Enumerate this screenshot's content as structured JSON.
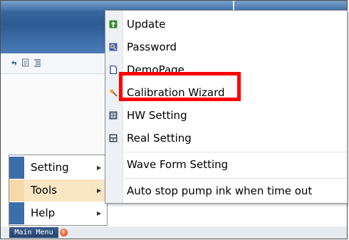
{
  "colors": {
    "accent": "#3d6ea7",
    "selected": "#fbe6c4",
    "highlight_box": "#ff0000"
  },
  "start_menu": {
    "items": [
      {
        "label": "Setting",
        "has_submenu": true,
        "selected": false
      },
      {
        "label": "Tools",
        "has_submenu": true,
        "selected": true
      },
      {
        "label": "Help",
        "has_submenu": true,
        "selected": false
      }
    ]
  },
  "tools_submenu": {
    "items": [
      {
        "label": "Update",
        "icon": "update-icon"
      },
      {
        "label": "Password",
        "icon": "password-icon"
      },
      {
        "label": "DemoPage",
        "icon": "page-icon"
      },
      {
        "label": "Calibration Wizard",
        "icon": "wizard-icon",
        "highlighted": true
      },
      {
        "label": "HW Setting",
        "icon": "hw-setting-icon"
      },
      {
        "label": "Real Setting",
        "icon": "real-setting-icon"
      },
      {
        "label": "Wave Form Setting",
        "icon": ""
      },
      {
        "label": "Auto stop pump ink when time out",
        "icon": ""
      }
    ]
  },
  "taskbar": {
    "main_menu_label": "Main Menu",
    "alert_icon": "alert-icon"
  },
  "toolbar": {
    "icons": [
      "undo-icon",
      "document-icon",
      "list-icon"
    ]
  }
}
